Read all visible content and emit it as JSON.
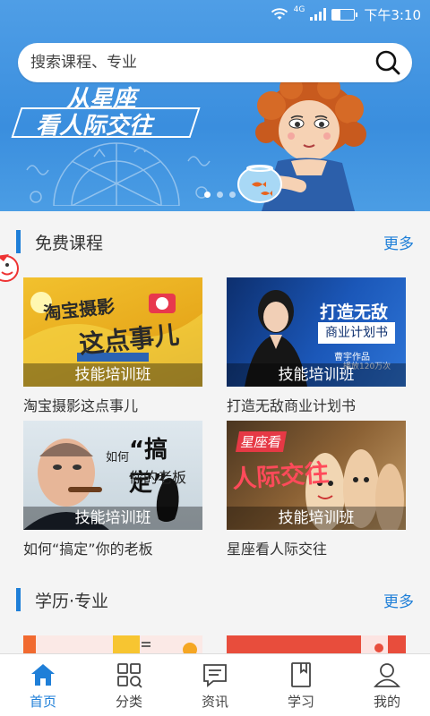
{
  "status_bar": {
    "network": "4G",
    "time": "下午3:10"
  },
  "search": {
    "placeholder": "搜索课程、专业"
  },
  "banner": {
    "line1": "从星座",
    "line2": "看人际交往",
    "slides": 3,
    "active_slide": 1
  },
  "free_section": {
    "title": "免费课程",
    "more": "更多",
    "courses": [
      {
        "thumb_text": "淘宝摄影这点事儿",
        "tag": "技能培训班",
        "name": "淘宝摄影这点事儿"
      },
      {
        "thumb_text": "打造无敌",
        "thumb_sub": "商业计划书",
        "thumb_author": "曹宇作品",
        "thumb_views": "播放120万次",
        "tag": "技能培训班",
        "name": "打造无敌商业计划书"
      },
      {
        "thumb_text": "搞定",
        "thumb_pre": "如何",
        "thumb_sub": "你的老板",
        "tag": "技能培训班",
        "name": "如何“搞定”你的老板"
      },
      {
        "thumb_text": "人际交往",
        "thumb_pre": "星座看",
        "tag": "技能培训班",
        "name": "星座看人际交往"
      }
    ]
  },
  "degree_section": {
    "title": "学历·专业",
    "more": "更多"
  },
  "bottom_nav": [
    {
      "label": "首页",
      "icon": "home-icon",
      "active": true
    },
    {
      "label": "分类",
      "icon": "category-icon",
      "active": false
    },
    {
      "label": "资讯",
      "icon": "news-icon",
      "active": false
    },
    {
      "label": "学习",
      "icon": "study-icon",
      "active": false
    },
    {
      "label": "我的",
      "icon": "profile-icon",
      "active": false
    }
  ],
  "colors": {
    "accent": "#1f7fd8",
    "banner": "#3a8ede"
  }
}
